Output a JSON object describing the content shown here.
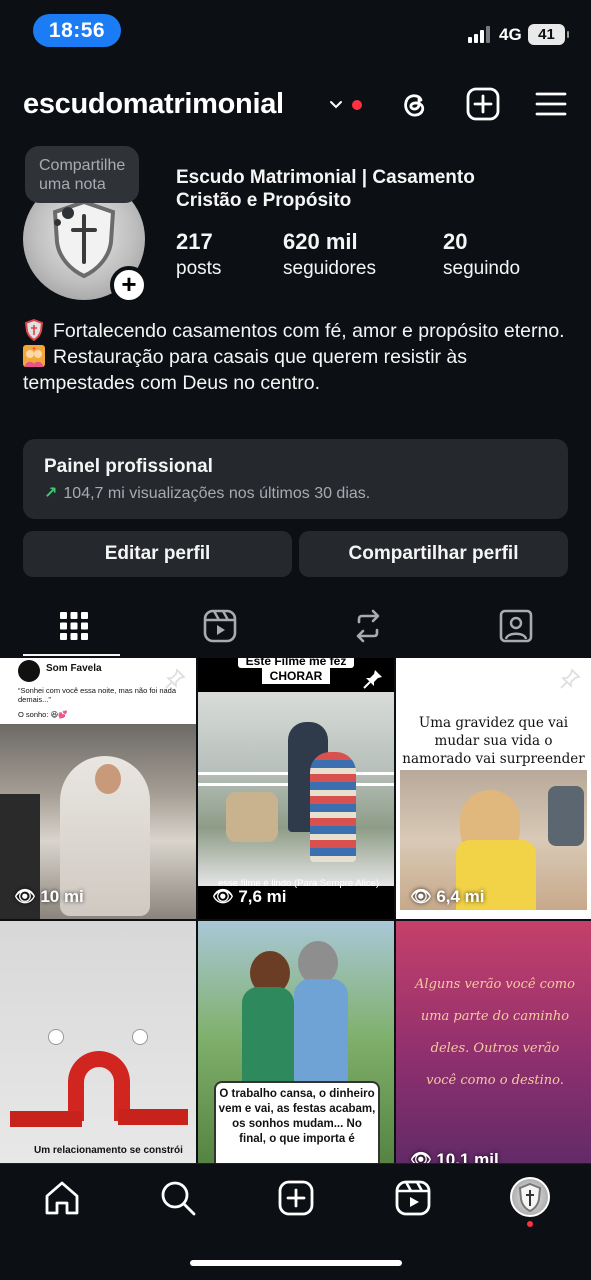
{
  "status_bar": {
    "time": "18:56",
    "network": "4G",
    "battery": "41"
  },
  "header": {
    "username": "escudomatrimonial",
    "icons": [
      "threads-icon",
      "create-icon",
      "menu-icon"
    ]
  },
  "profile": {
    "note": "Compartilhe uma nota",
    "display_name": "Escudo Matrimonial | Casamento Cristão e Propósito",
    "stats": {
      "posts": {
        "value": "217",
        "label": "posts"
      },
      "followers": {
        "value": "620 mil",
        "label": "seguidores"
      },
      "following": {
        "value": "20",
        "label": "seguindo"
      }
    },
    "bio_line1": "Fortalecendo casamentos com fé, amor e propósito eterno.",
    "bio_line2": "Restauração para casais que querem resistir às tempestades com Deus no centro."
  },
  "dashboard": {
    "title": "Painel profissional",
    "subtitle": "104,7 mi visualizações nos últimos 30 dias."
  },
  "buttons": {
    "edit": "Editar perfil",
    "share": "Compartilhar perfil"
  },
  "colors": {
    "background": "#0c1014",
    "card": "#25292e",
    "accent": "#1b7cf5",
    "notification": "#ff3040",
    "trend": "#3ccb72"
  },
  "posts": [
    {
      "views": "10 mi",
      "pinned": true,
      "header_name": "Som Favela",
      "header_text": "“Sonhei com você essa noite, mas não foi nada demais...”",
      "header_text2": "O sonho: 😆💕"
    },
    {
      "views": "7,6 mi",
      "pinned": true,
      "top_text": "Este Filme me fez",
      "top_text2": "CHORAR",
      "caption": "esse filme é lindo (Para Sempre Alice)"
    },
    {
      "views": "6,4 mi",
      "pinned": true,
      "text": "Uma gravidez que vai mudar sua vida o namorado vai surpreender ela"
    },
    {
      "views": "",
      "caption": "Um relacionamento se constrói"
    },
    {
      "views": "",
      "text": "O trabalho cansa, o dinheiro vem e vai, as festas acabam, os sonhos mudam... No final, o que importa é"
    },
    {
      "views": "10,1 mil",
      "text": "Alguns verão você como uma parte do caminho deles. Outros verão você como o destino."
    }
  ],
  "bottom_nav": [
    "home-icon",
    "search-icon",
    "create-icon",
    "reels-icon",
    "profile-avatar"
  ]
}
